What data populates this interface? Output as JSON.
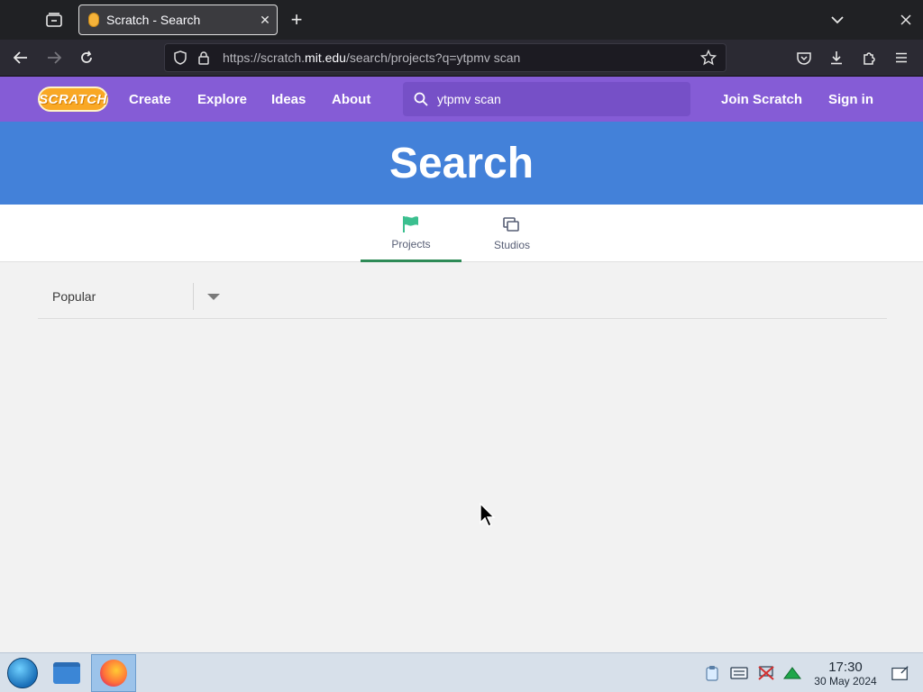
{
  "browser": {
    "tab_title": "Scratch - Search",
    "tab_close": "✕",
    "new_tab": "+",
    "url_scheme": "https://scratch.",
    "url_domain": "mit.edu",
    "url_path": "/search/projects?q=ytpmv scan"
  },
  "scratch_nav": {
    "logo": "SCRATCH",
    "links": [
      "Create",
      "Explore",
      "Ideas",
      "About"
    ],
    "search_value": "ytpmv scan",
    "join": "Join Scratch",
    "sign_in": "Sign in",
    "color": "#855cd6"
  },
  "banner": {
    "title": "Search",
    "color": "#4381d9"
  },
  "tabs": [
    {
      "label": "Projects",
      "icon": "flag-icon",
      "active": true
    },
    {
      "label": "Studios",
      "icon": "studios-icon",
      "active": false
    }
  ],
  "sort": {
    "selected": "Popular"
  },
  "taskbar": {
    "time": "17:30",
    "date": "30 May 2024"
  }
}
